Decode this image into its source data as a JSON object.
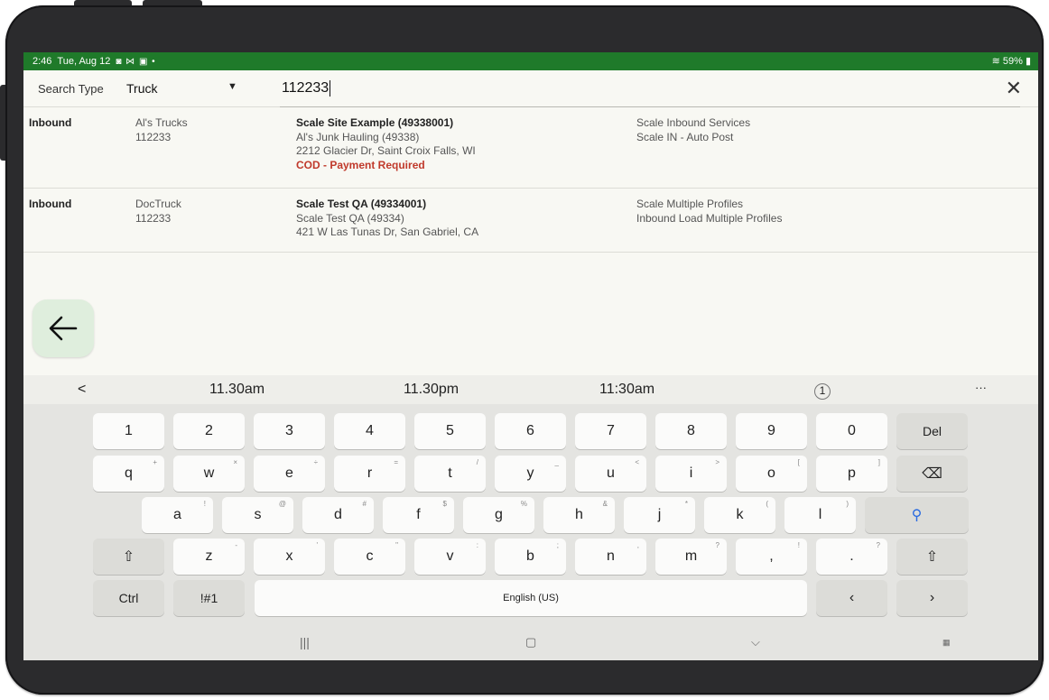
{
  "status": {
    "time": "2:46",
    "date": "Tue, Aug 12",
    "icons": "◙ ⋈ ▣ •",
    "wifi": "≋",
    "battery": "59%"
  },
  "search": {
    "type_label": "Search Type",
    "type_value": "Truck",
    "query": "112233"
  },
  "results": [
    {
      "direction": "Inbound",
      "truck_name": "Al's Trucks",
      "truck_id": "112233",
      "site": "Scale Site Example (49338001)",
      "company": "Al's Junk Hauling (49338)",
      "address": "2212 Glacier Dr, Saint Croix Falls, WI",
      "alert": "COD - Payment Required",
      "service1": "Scale Inbound Services",
      "service2": "Scale IN - Auto Post"
    },
    {
      "direction": "Inbound",
      "truck_name": "DocTruck",
      "truck_id": "112233",
      "site": "Scale Test QA (49334001)",
      "company": "Scale Test QA (49334)",
      "address": "421 W Las Tunas Dr, San Gabriel, CA",
      "service1": "Scale Multiple Profiles",
      "service2": "Inbound Load Multiple Profiles"
    }
  ],
  "suggestions": [
    "11.30am",
    "11.30pm",
    "11:30am"
  ],
  "keyboard": {
    "row1": [
      "1",
      "2",
      "3",
      "4",
      "5",
      "6",
      "7",
      "8",
      "9",
      "0",
      "Del"
    ],
    "row2": [
      [
        "q",
        "+"
      ],
      [
        "w",
        "×"
      ],
      [
        "e",
        "÷"
      ],
      [
        "r",
        "="
      ],
      [
        "t",
        "/"
      ],
      [
        "y",
        "_"
      ],
      [
        "u",
        "<"
      ],
      [
        "i",
        ">"
      ],
      [
        "o",
        "["
      ],
      [
        "p",
        "]"
      ]
    ],
    "row3": [
      [
        "a",
        "!"
      ],
      [
        "s",
        "@"
      ],
      [
        "d",
        "#"
      ],
      [
        "f",
        "$"
      ],
      [
        "g",
        "%"
      ],
      [
        "h",
        "&"
      ],
      [
        "j",
        "*"
      ],
      [
        "k",
        "("
      ],
      [
        "l",
        ")"
      ]
    ],
    "row4": [
      [
        "z",
        "-"
      ],
      [
        "x",
        "'"
      ],
      [
        "c",
        "\""
      ],
      [
        "v",
        ":"
      ],
      [
        "b",
        ";"
      ],
      [
        "n",
        ","
      ],
      [
        "m",
        "?"
      ]
    ],
    "row4_punct": [
      [
        ",",
        "!"
      ],
      [
        ".",
        "?"
      ]
    ],
    "ctrl": "Ctrl",
    "symbols": "!#1",
    "space": "English (US)"
  },
  "colors": {
    "status_bar": "#1f7a2a",
    "alert": "#c0392b",
    "accent": "#2a6be0",
    "fab": "#dfeedd"
  }
}
